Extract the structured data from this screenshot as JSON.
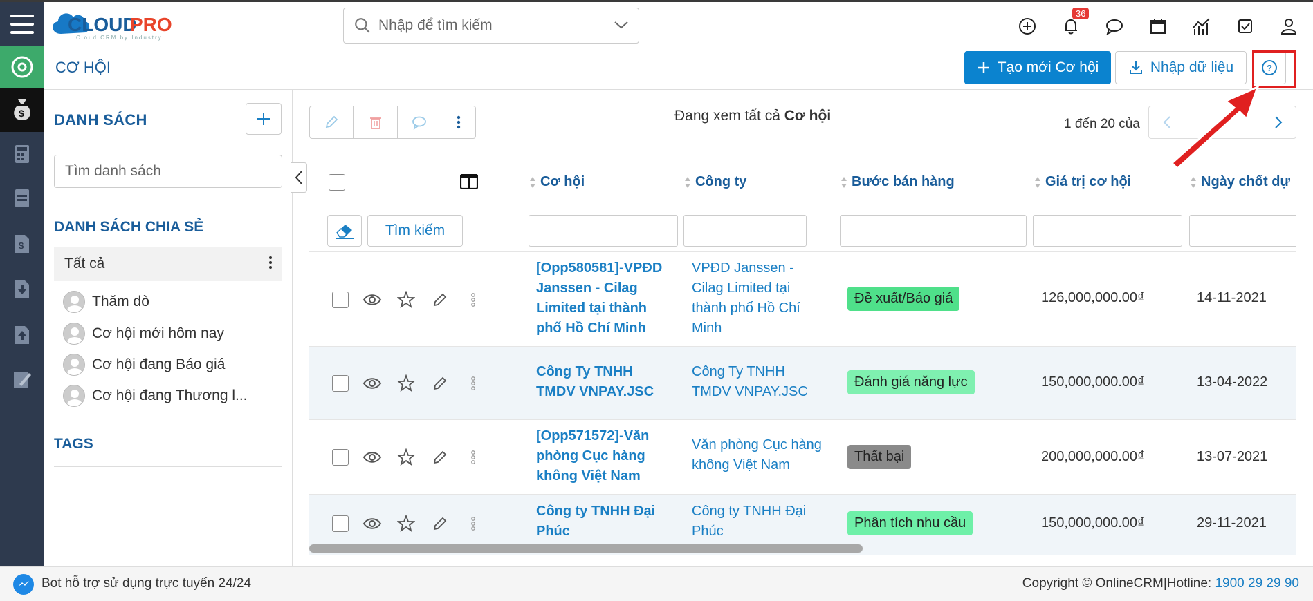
{
  "header": {
    "logo_text": "CLOUDPRO",
    "logo_tagline": "Cloud CRM by Industry",
    "search_placeholder": "Nhập để tìm kiếm",
    "notification_count": "36"
  },
  "titlebar": {
    "title": "CƠ HỘI",
    "create_label": "Tạo mới Cơ hội",
    "import_label": "Nhập dữ liệu"
  },
  "sidebar": {
    "list_title": "DANH SÁCH",
    "search_placeholder": "Tìm danh sách",
    "shared_title": "DANH SÁCH CHIA SẺ",
    "all_label": "Tất cả",
    "items": [
      {
        "label": "Thăm dò"
      },
      {
        "label": "Cơ hội mới hôm nay"
      },
      {
        "label": "Cơ hội đang Báo giá"
      },
      {
        "label": "Cơ hội đang Thương l..."
      }
    ],
    "tags_title": "TAGS"
  },
  "toolbar": {
    "viewing_prefix": "Đang xem tất cả",
    "viewing_module": "Cơ hội",
    "page_info": "1 đến 20 của",
    "page_unknown": "?"
  },
  "table": {
    "columns": [
      "Cơ hội",
      "Công ty",
      "Bước bán hàng",
      "Giá trị cơ hội",
      "Ngày chốt dự"
    ],
    "find_label": "Tìm kiếm",
    "rows": [
      {
        "name": "[Opp580581]-VPĐD Janssen - Cilag Limited tại thành phố Hồ Chí Minh",
        "company": "VPĐD Janssen - Cilag Limited tại thành phố Hồ Chí Minh",
        "stage": "Đề xuất/Báo giá",
        "stage_color": "#4fe08a",
        "value": "126,000,000.00₫",
        "date": "14-11-2021"
      },
      {
        "name": "Công Ty TNHH TMDV VNPAY.JSC",
        "company": "Công Ty TNHH TMDV VNPAY.JSC",
        "stage": "Đánh giá năng lực",
        "stage_color": "#7ff0b0",
        "value": "150,000,000.00₫",
        "date": "13-04-2022"
      },
      {
        "name": "[Opp571572]-Văn phòng Cục hàng không Việt Nam",
        "company": "Văn phòng Cục hàng không Việt Nam",
        "stage": "Thất bại",
        "stage_color": "#8a8a8a",
        "value": "200,000,000.00₫",
        "date": "13-07-2021"
      },
      {
        "name": "Công ty TNHH Đại Phúc",
        "company": "Công ty TNHH Đại Phúc",
        "stage": "Phân tích nhu cầu",
        "stage_color": "#6ef0a8",
        "value": "150,000,000.00₫",
        "date": "29-11-2021"
      }
    ]
  },
  "footer": {
    "bot_text": "Bot hỗ trợ sử dụng trực tuyến 24/24",
    "copyright": "Copyright © OnlineCRM|Hotline: ",
    "hotline": "1900 29 29 90"
  },
  "colors": {
    "brand_blue": "#0b83cf",
    "rail_bg": "#2e3a4e",
    "active_green": "#3daa6b",
    "highlight_red": "#e02020"
  }
}
